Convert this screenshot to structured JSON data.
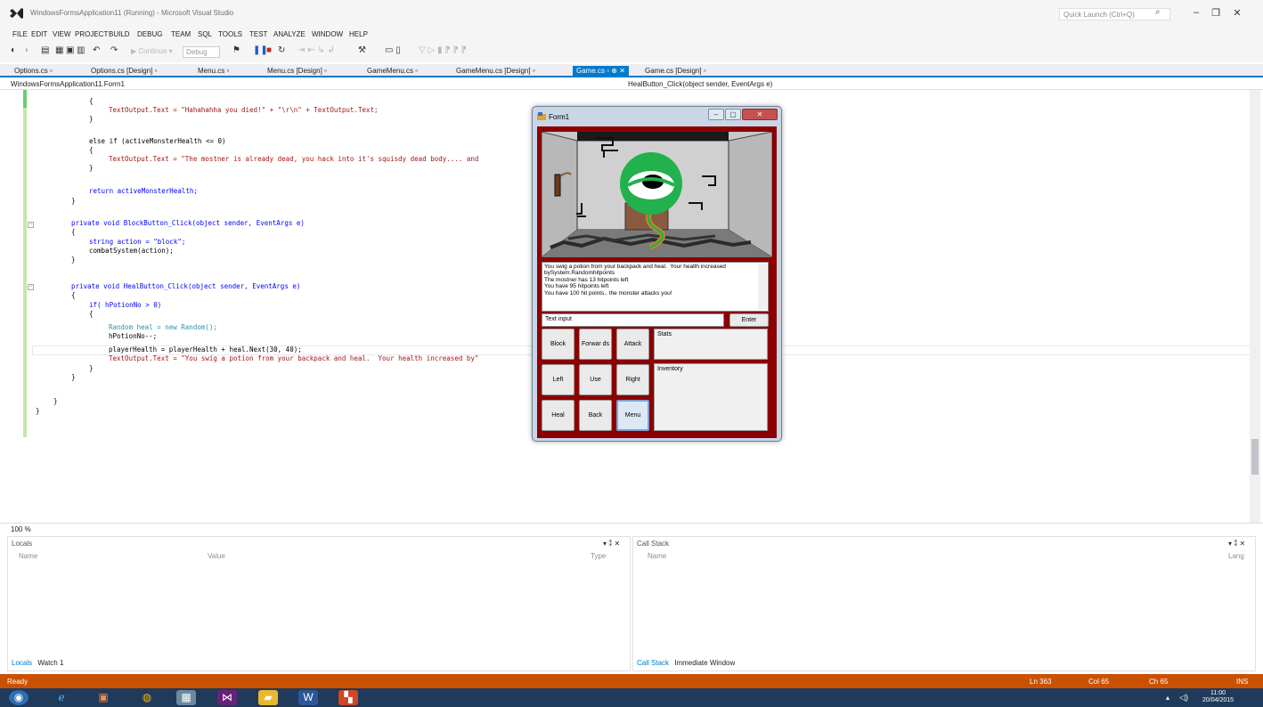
{
  "app": {
    "window_title": "WindowsFormsApplication11 (Running) - Microsoft Visual Studio",
    "quick_launch_placeholder": "Quick Launch (Ctrl+Q)"
  },
  "menu": [
    "FILE",
    "EDIT",
    "VIEW",
    "PROJECT",
    "BUILD",
    "DEBUG",
    "TEAM",
    "SQL",
    "TOOLS",
    "TEST",
    "ANALYZE",
    "WINDOW",
    "HELP"
  ],
  "toolbar": {
    "continue_label": "▶ Continue ▾",
    "config_value": "Debug"
  },
  "tabs": [
    {
      "label": "Options.cs ▫"
    },
    {
      "label": "Options.cs [Design] ▫"
    },
    {
      "label": "Menu.cs ▫"
    },
    {
      "label": "Menu.cs [Design] ▫"
    },
    {
      "label": "GameMenu.cs ▫"
    },
    {
      "label": "GameMenu.cs [Design] ▫"
    },
    {
      "label": "Game.cs ▫ ⊕ ✕"
    },
    {
      "label": "Game.cs [Design] ▫"
    }
  ],
  "navbar": {
    "class_path": "WindowsFormsApplication11.Form1",
    "member": "HealButton_Click(object sender, EventArgs e)"
  },
  "code": {
    "l1": "{",
    "l2": "TextOutput.Text = \"Hahahahha you died!\" + \"\\r\\n\" + TextOutput.Text;",
    "l3": "}",
    "l4": "else if (activeMonsterHealth <= 0)",
    "l5": "{",
    "l6": "TextOutput.Text = \"The mostner is already dead, you hack into it's squisdy dead body.... and",
    "l7": "}",
    "l8": "return activeMonsterHealth;",
    "l9": "}",
    "l10": "private void BlockButton_Click(object sender, EventArgs e)",
    "l11": "{",
    "l12": "string action = \"block\";",
    "l13": "combatSystem(action);",
    "l14": "}",
    "l15": "private void HealButton_Click(object sender, EventArgs e)",
    "l16": "{",
    "l17": "if( hPotionNo > 0)",
    "l18": "{",
    "l19": "Random heal = new Random();",
    "l20": "hPotionNo--;",
    "l21": "playerHealth = playerHealth + heal.Next(30, 40);",
    "l22": "TextOutput.Text = \"You swig a potion from your backpack and heal.  Your health increased by\"",
    "l23": "}",
    "l24": "}",
    "l25": "}",
    "l26": "}"
  },
  "zoom": "100 %",
  "locals": {
    "title": "Locals",
    "cols": [
      "Name",
      "Value",
      "Type"
    ],
    "tabs": [
      "Locals",
      "Watch 1"
    ]
  },
  "callstack": {
    "title": "Call Stack",
    "cols": [
      "Name",
      "Lang"
    ],
    "tabs": [
      "Call Stack",
      "Immediate Window"
    ]
  },
  "status": {
    "state": "Ready",
    "ln": "Ln 363",
    "col": "Col 65",
    "ch": "Ch 65",
    "mode": "INS"
  },
  "clock": {
    "time": "11:00",
    "date": "20/04/2015"
  },
  "form1": {
    "title": "Form1",
    "output_text": "You swig a potion from your backpack and heal.  Your health increased bySystem.Randomhitpoints\nThe mostner has 13 hitpoints left\nYou have 95 hitpoints left\nYou have 100 hit points.. the monster attacks you!",
    "input_value": "Text input",
    "enter": "Enter",
    "buttons": {
      "block": "Block",
      "forwards": "Forwar ds",
      "attack": "Attack",
      "left": "Left",
      "use": "Use",
      "right": "Right",
      "heal": "Heal",
      "back": "Back",
      "menu": "Menu"
    },
    "stats_label": "Stats",
    "inventory_label": "Inventory"
  },
  "colors": {
    "accent": "#007acc",
    "status_bar": "#ca5100",
    "form_bg": "#8b0000",
    "monster": "#22b14c"
  }
}
